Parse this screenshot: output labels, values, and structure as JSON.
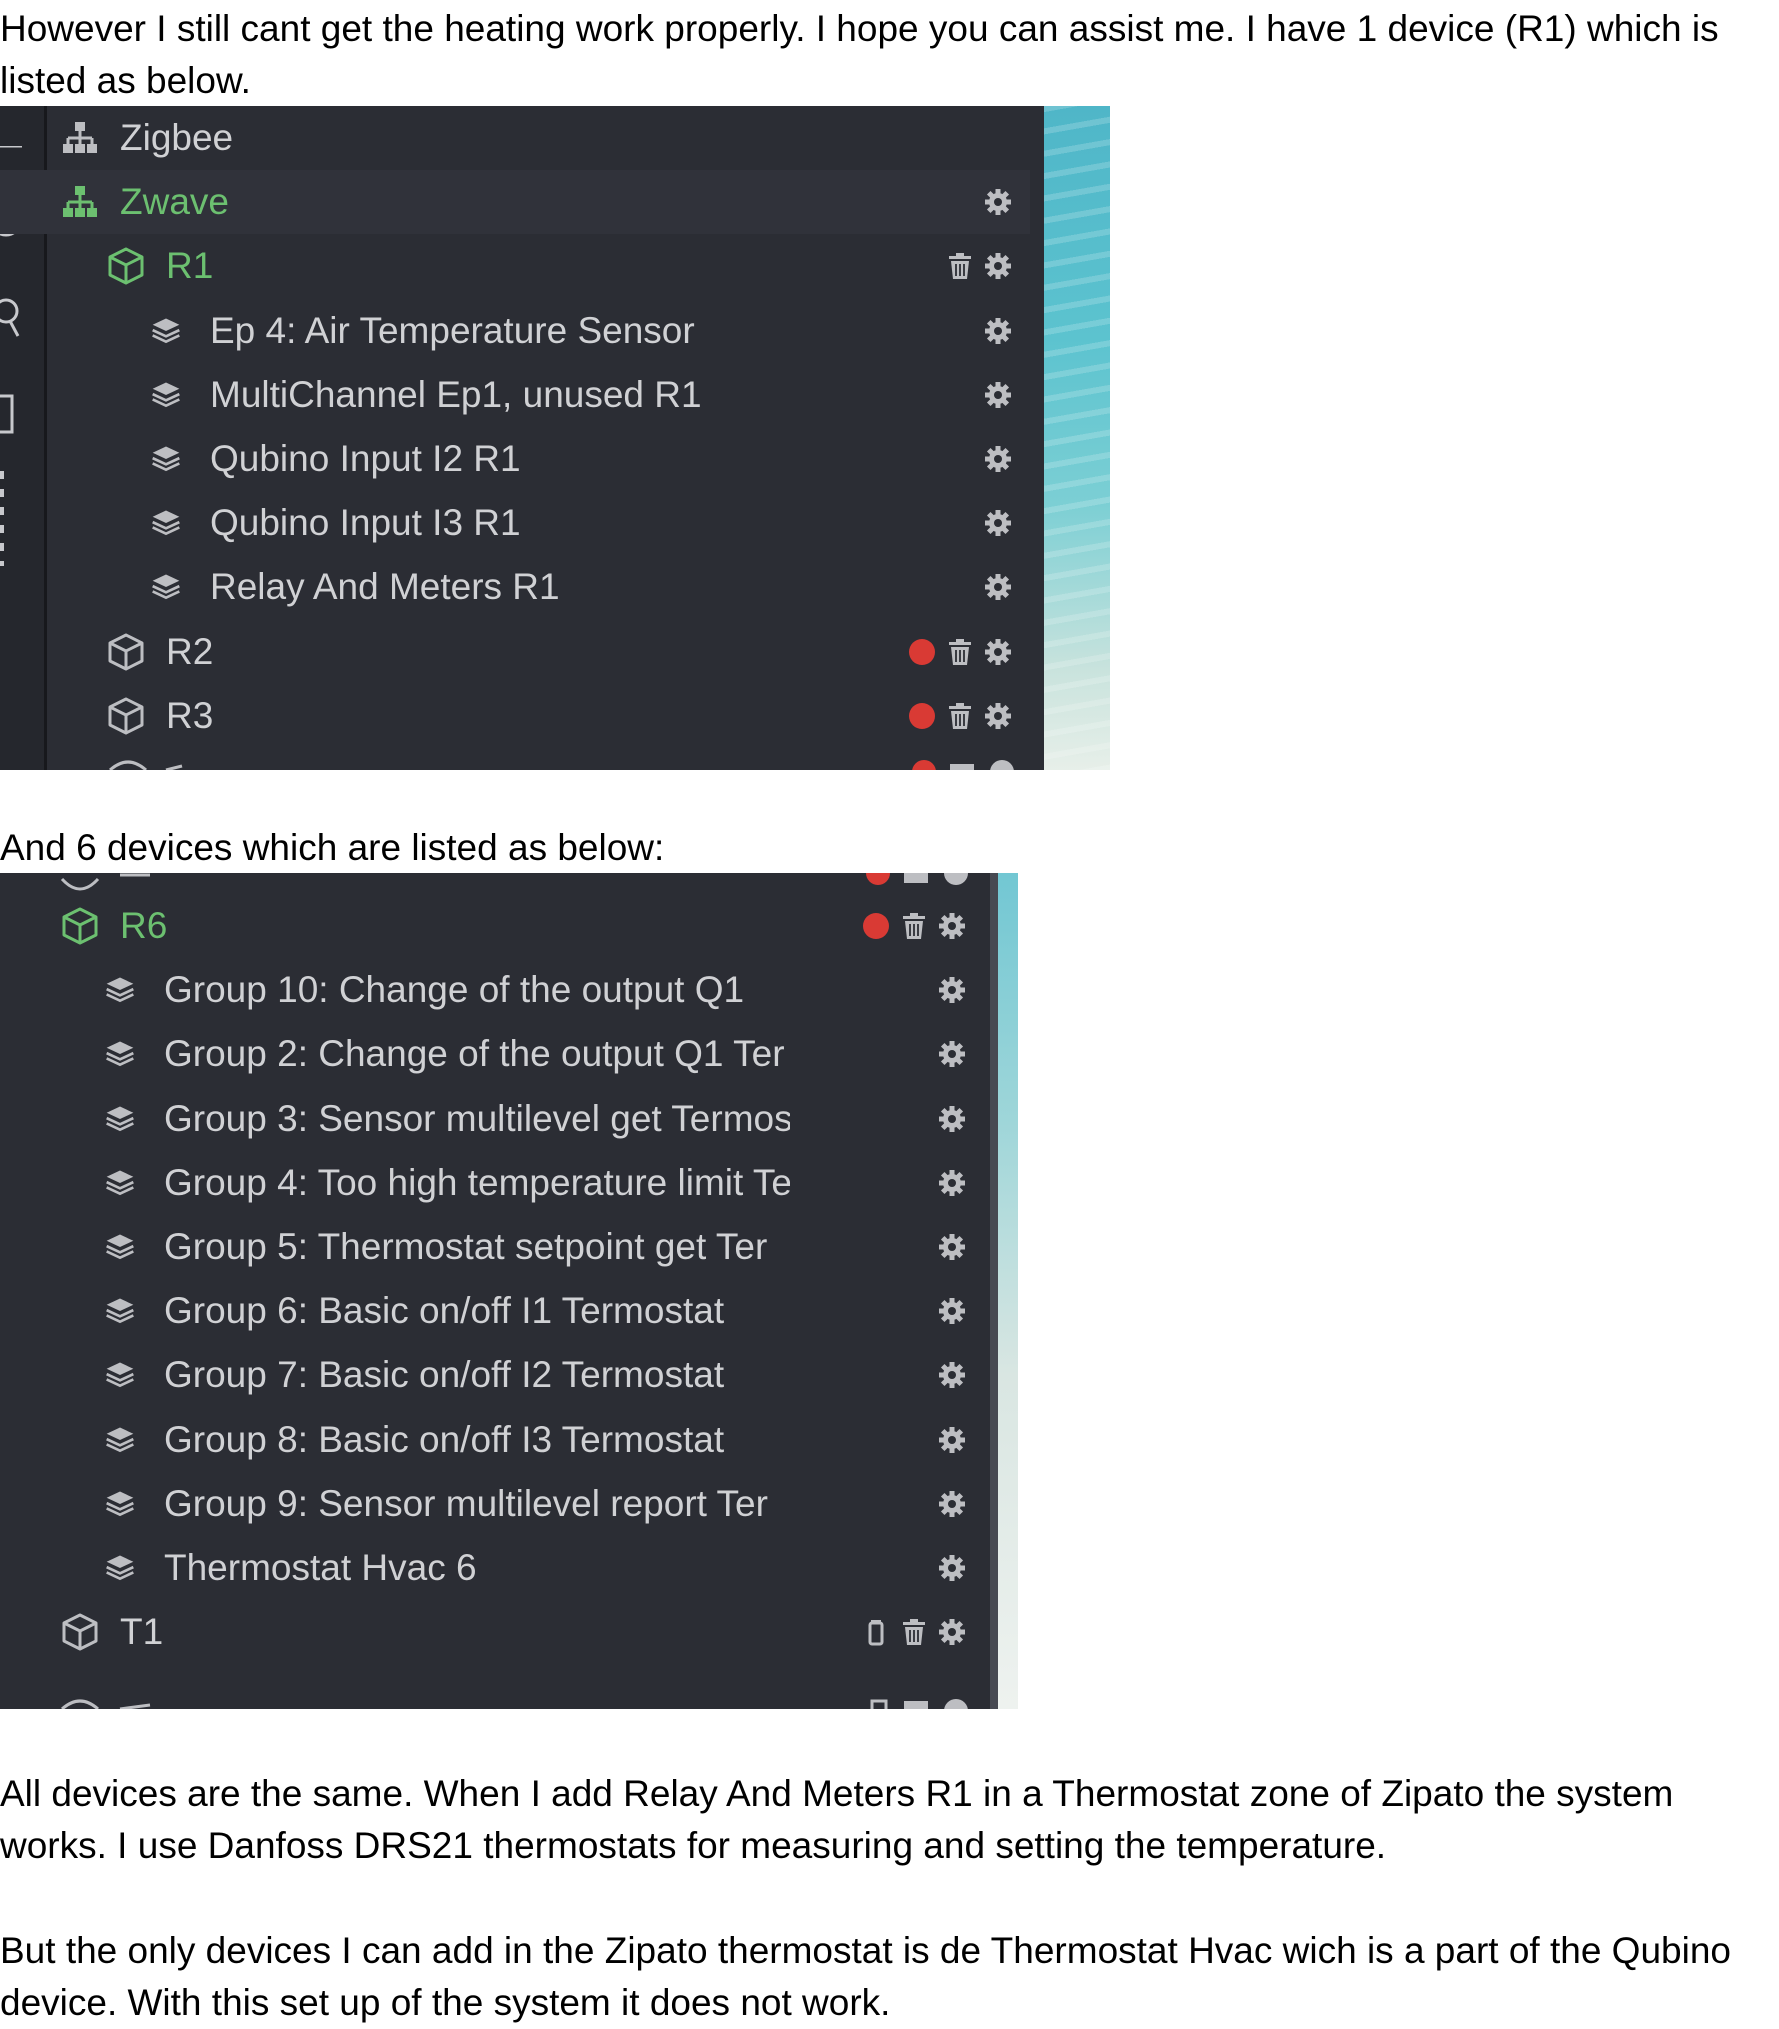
{
  "text": {
    "intro": "However I still cant get the heating work properly. I hope you can assist me. I have 1 device (R1) which is listed as below.",
    "six_devices": "And 6 devices which are listed as below:",
    "para3": "All devices are the same. When I add Relay And Meters R1 in a Thermostat zone of Zipato the system works. I use Danfoss DRS21 thermostats for measuring and setting the temperature.",
    "para4": "But the only devices I can add in the Zipato thermostat is de Thermostat Hvac wich is a part of the Qubino device. With this set up of the system it does not work."
  },
  "panel1": {
    "rows": [
      {
        "label": "Zigbee",
        "type": "network",
        "level": 0,
        "green": false,
        "actions": []
      },
      {
        "label": "Zwave",
        "type": "network",
        "level": 0,
        "green": true,
        "actions": [
          "gear"
        ]
      },
      {
        "label": "R1",
        "type": "device",
        "level": 1,
        "green": true,
        "actions": [
          "trash",
          "gear"
        ]
      },
      {
        "label": "Ep 4: Air Temperature Sensor",
        "type": "endpoint",
        "level": 2,
        "green": false,
        "actions": [
          "gear"
        ]
      },
      {
        "label": "MultiChannel Ep1, unused R1",
        "type": "endpoint",
        "level": 2,
        "green": false,
        "actions": [
          "gear"
        ]
      },
      {
        "label": "Qubino Input I2 R1",
        "type": "endpoint",
        "level": 2,
        "green": false,
        "actions": [
          "gear"
        ]
      },
      {
        "label": "Qubino Input I3 R1",
        "type": "endpoint",
        "level": 2,
        "green": false,
        "actions": [
          "gear"
        ]
      },
      {
        "label": "Relay And Meters R1",
        "type": "endpoint",
        "level": 2,
        "green": false,
        "actions": [
          "gear"
        ]
      },
      {
        "label": "R2",
        "type": "device",
        "level": 1,
        "green": false,
        "actions": [
          "dot",
          "trash",
          "gear"
        ]
      },
      {
        "label": "R3",
        "type": "device",
        "level": 1,
        "green": false,
        "actions": [
          "dot",
          "trash",
          "gear"
        ]
      }
    ]
  },
  "panel2": {
    "rows": [
      {
        "label": "R6",
        "type": "device",
        "level": 1,
        "green": true,
        "actions": [
          "dot",
          "trash",
          "gear"
        ]
      },
      {
        "label": "Group 10: Change of the output Q1",
        "type": "endpoint",
        "level": 2,
        "green": false,
        "actions": [
          "gear"
        ]
      },
      {
        "label": "Group 2: Change of the output Q1 Ter",
        "type": "endpoint",
        "level": 2,
        "green": false,
        "actions": [
          "gear"
        ]
      },
      {
        "label": "Group 3: Sensor multilevel get Termos",
        "type": "endpoint",
        "level": 2,
        "green": false,
        "actions": [
          "gear"
        ]
      },
      {
        "label": "Group 4: Too high temperature limit Te",
        "type": "endpoint",
        "level": 2,
        "green": false,
        "actions": [
          "gear"
        ]
      },
      {
        "label": "Group 5: Thermostat setpoint get Ter",
        "type": "endpoint",
        "level": 2,
        "green": false,
        "actions": [
          "gear"
        ]
      },
      {
        "label": "Group 6: Basic on/off I1 Termostat",
        "type": "endpoint",
        "level": 2,
        "green": false,
        "actions": [
          "gear"
        ]
      },
      {
        "label": "Group 7: Basic on/off I2 Termostat",
        "type": "endpoint",
        "level": 2,
        "green": false,
        "actions": [
          "gear"
        ]
      },
      {
        "label": "Group 8: Basic on/off I3 Termostat",
        "type": "endpoint",
        "level": 2,
        "green": false,
        "actions": [
          "gear"
        ]
      },
      {
        "label": "Group 9: Sensor multilevel report Ter",
        "type": "endpoint",
        "level": 2,
        "green": false,
        "actions": [
          "gear"
        ]
      },
      {
        "label": "Thermostat Hvac 6",
        "type": "endpoint",
        "level": 2,
        "green": false,
        "actions": [
          "gear"
        ]
      },
      {
        "label": "T1",
        "type": "device",
        "level": 1,
        "green": false,
        "actions": [
          "battery",
          "trash",
          "gear"
        ]
      }
    ]
  },
  "colors": {
    "panel_bg": "#2b2d34",
    "text": "#d0d1d4",
    "green": "#6cc070",
    "red_dot": "#d93a34",
    "icon_gray": "#bdbec2"
  }
}
